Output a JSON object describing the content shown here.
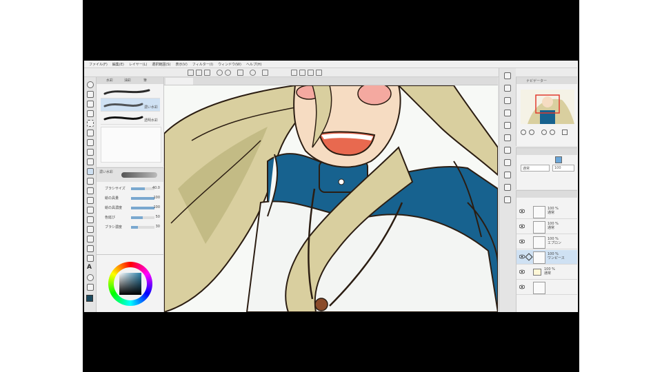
{
  "menubar": {
    "items": [
      "ファイル(F)",
      "編集(E)",
      "レイヤー(L)",
      "選択範囲(S)",
      "表示(V)",
      "フィルター(I)",
      "ウィンドウ(W)",
      "ヘルプ(H)"
    ]
  },
  "subtool": {
    "tabs": [
      "水彩",
      "油彩",
      "筆"
    ],
    "brushes": [
      {
        "label": ""
      },
      {
        "label": "濃い水彩"
      },
      {
        "label": "透明水彩"
      }
    ]
  },
  "tool_property": {
    "title": "濃い水彩",
    "rows": [
      {
        "label": "ブラシサイズ",
        "value": "40.0"
      },
      {
        "label": "絵の具量",
        "value": "100"
      },
      {
        "label": "絵の具濃度",
        "value": "100"
      },
      {
        "label": "色延び",
        "value": "50"
      },
      {
        "label": "ブラシ濃度",
        "value": "30"
      }
    ]
  },
  "navigator": {
    "title": "ナビゲーター"
  },
  "layer_props": {
    "blend_mode": "通常",
    "opacity": "100"
  },
  "layers": [
    {
      "name": "通常",
      "opacity": "100 %"
    },
    {
      "name": "通常",
      "opacity": "100 %"
    },
    {
      "name": "エプロン",
      "opacity": "100 %"
    },
    {
      "name": "ワンピース",
      "opacity": "100 %"
    },
    {
      "name": "通常",
      "opacity": "100 %"
    },
    {
      "name": "",
      "opacity": ""
    }
  ],
  "colors": {
    "hair_base": "#d9cf9f",
    "hair_shadow": "#b9b27b",
    "dress_blue": "#17628f",
    "cheek": "#f4a9a0",
    "mouth": "#e8694f",
    "skin": "#f6dcc2",
    "outline": "#2b1d12"
  }
}
